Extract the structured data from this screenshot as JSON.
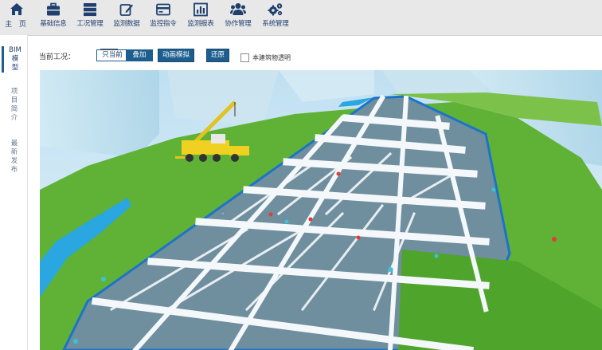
{
  "nav": {
    "home": {
      "label": "主 页",
      "icon": "home-icon"
    },
    "items": [
      {
        "label": "基础信息",
        "icon": "briefcase-icon"
      },
      {
        "label": "工况管理",
        "icon": "server-icon"
      },
      {
        "label": "监测数据",
        "icon": "edit-icon"
      },
      {
        "label": "监控指令",
        "icon": "card-icon"
      },
      {
        "label": "监测报表",
        "icon": "bar-chart-icon"
      },
      {
        "label": "协作管理",
        "icon": "users-icon"
      },
      {
        "label": "系统管理",
        "icon": "gears-icon"
      }
    ]
  },
  "sidebar": {
    "tabs": [
      {
        "lines": [
          "BIM",
          "模",
          "型"
        ],
        "active": true
      },
      {
        "lines": [
          "项",
          "目",
          "简",
          "介"
        ],
        "active": false
      },
      {
        "lines": [
          "最",
          "新",
          "发",
          "布"
        ],
        "active": false
      }
    ]
  },
  "toolbar": {
    "condition_label": "当前工况：",
    "condition_value": "",
    "seg_only_current": "只当前",
    "seg_overlay": "叠加",
    "animate_button": "动画模拟",
    "restore_button": "还原",
    "transparent_label": "本建筑物透明",
    "transparent_checked": false
  },
  "colors": {
    "accent": "#1d5e8e",
    "nav_text": "#1f3f6e",
    "grass": "#5fb235",
    "water": "#2aa6e0"
  }
}
